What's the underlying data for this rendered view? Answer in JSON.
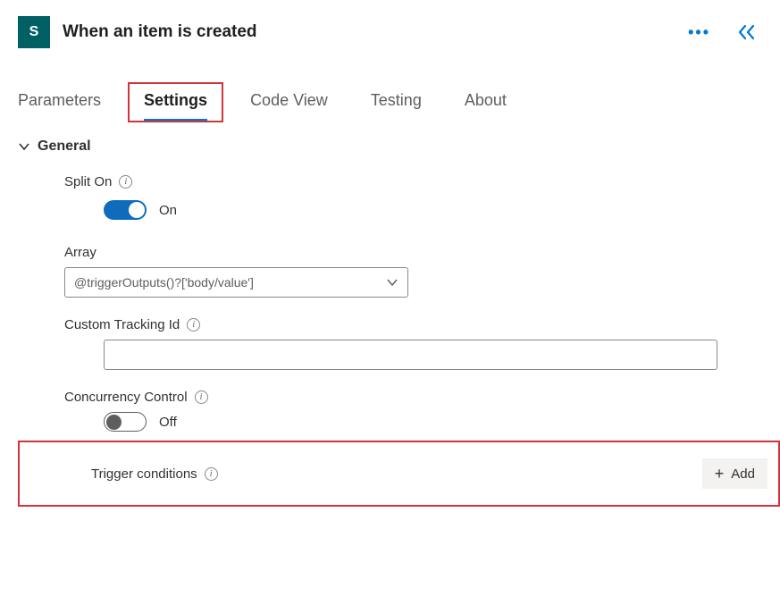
{
  "header": {
    "title": "When an item is created",
    "icon_glyph": "S",
    "icon_name": "sharepoint-icon"
  },
  "tabs": {
    "parameters": "Parameters",
    "settings": "Settings",
    "codeview": "Code View",
    "testing": "Testing",
    "about": "About"
  },
  "section": {
    "title": "General"
  },
  "splitOn": {
    "label": "Split On",
    "state": "On"
  },
  "array": {
    "label": "Array",
    "value": "@triggerOutputs()?['body/value']"
  },
  "customTracking": {
    "label": "Custom Tracking Id",
    "value": ""
  },
  "concurrency": {
    "label": "Concurrency Control",
    "state": "Off"
  },
  "triggerConditions": {
    "label": "Trigger conditions",
    "addLabel": "Add"
  }
}
